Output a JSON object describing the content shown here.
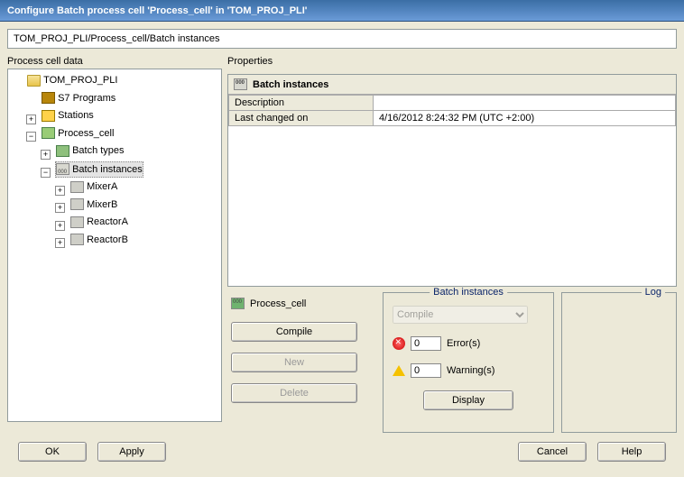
{
  "window": {
    "title": "Configure Batch process cell 'Process_cell' in 'TOM_PROJ_PLI'"
  },
  "breadcrumb": "TOM_PROJ_PLI/Process_cell/Batch instances",
  "labels": {
    "process_cell_data": "Process cell data",
    "properties": "Properties"
  },
  "tree": {
    "root": "TOM_PROJ_PLI",
    "s7": "S7 Programs",
    "stations": "Stations",
    "process_cell": "Process_cell",
    "batch_types": "Batch types",
    "batch_instances": "Batch instances",
    "mixerA": "MixerA",
    "mixerB": "MixerB",
    "reactorA": "ReactorA",
    "reactorB": "ReactorB"
  },
  "properties": {
    "heading": "Batch instances",
    "rows": {
      "description": {
        "k": "Description",
        "v": ""
      },
      "last_changed": {
        "k": "Last changed on",
        "v": "4/16/2012 8:24:32 PM (UTC +2:00)"
      }
    }
  },
  "processCell": {
    "label": "Process_cell",
    "compile": "Compile",
    "new": "New",
    "delete": "Delete"
  },
  "batchInstances": {
    "group": "Batch instances",
    "combo": "Compile",
    "errors_count": "0",
    "errors_label": "Error(s)",
    "warnings_count": "0",
    "warnings_label": "Warning(s)",
    "display": "Display"
  },
  "log": {
    "group": "Log"
  },
  "footer": {
    "ok": "OK",
    "apply": "Apply",
    "cancel": "Cancel",
    "help": "Help"
  }
}
